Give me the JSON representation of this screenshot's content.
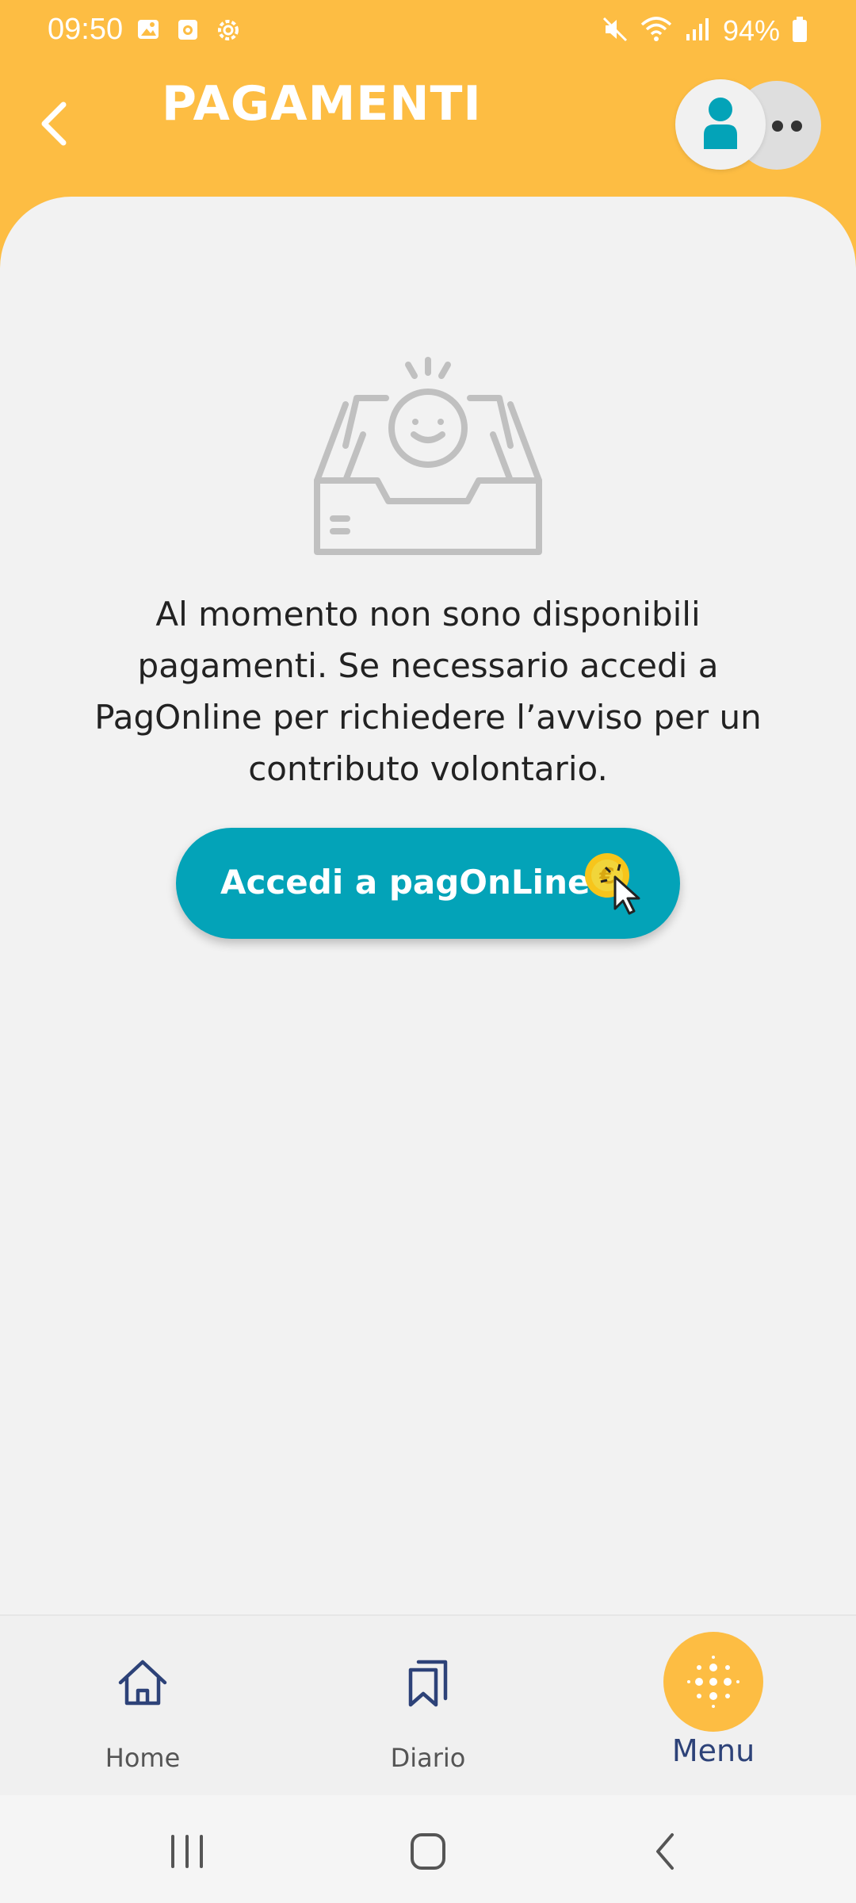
{
  "status_bar": {
    "time": "09:50",
    "battery": "94%"
  },
  "header": {
    "title": "PAGAMENTI",
    "background_color": "#fdbd43"
  },
  "empty_state": {
    "message": "Al momento non sono disponibili pagamenti. Se necessario accedi a PagOnline per richiedere l’avviso per un contributo volontario."
  },
  "pagonline_button": {
    "label": "Accedi a pagOnLine",
    "color": "#03a3b8"
  },
  "bottom_nav": {
    "items": [
      {
        "label": "Home",
        "icon": "home-icon"
      },
      {
        "label": "Diario",
        "icon": "bookmarks-icon"
      },
      {
        "label": "Menu",
        "icon": "menu-grid-icon",
        "active": true
      }
    ],
    "accent_color": "#2d4278"
  },
  "system_nav": {
    "buttons": [
      "recent-apps-icon",
      "home-button-icon",
      "back-icon"
    ]
  }
}
